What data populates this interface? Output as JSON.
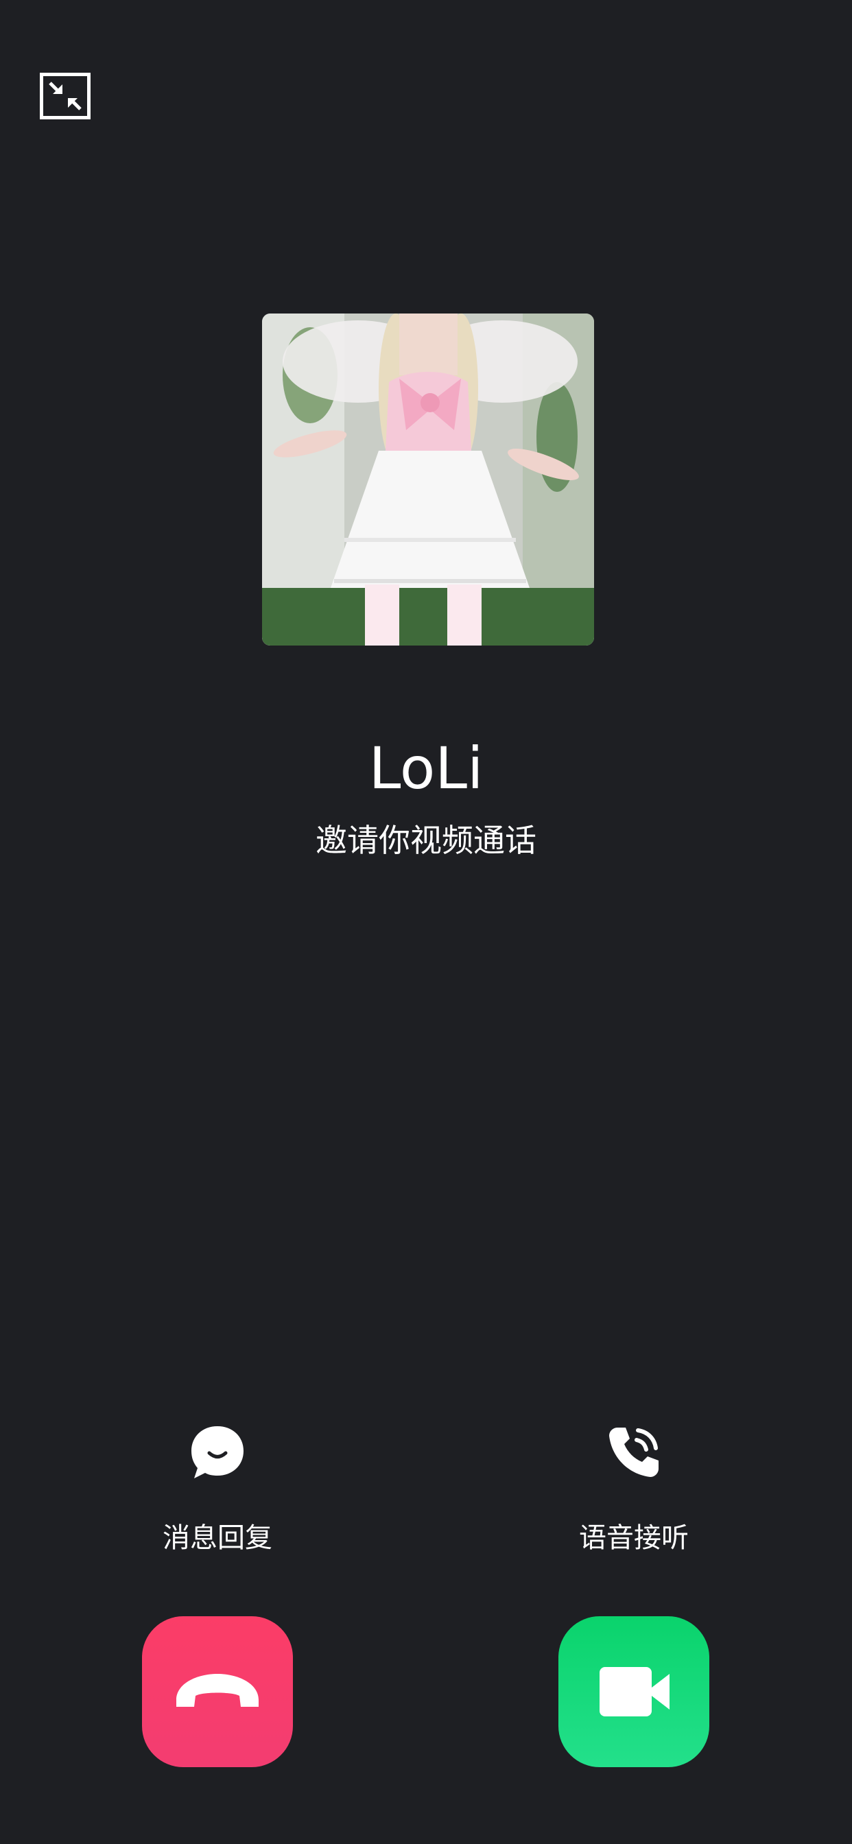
{
  "caller": {
    "name": "LoLi",
    "subtitle": "邀请你视频通话"
  },
  "options": {
    "message_reply_label": "消息回复",
    "voice_answer_label": "语音接听"
  },
  "icons": {
    "minimize": "minimize-icon",
    "message": "chat-bubble-icon",
    "voice": "phone-icon",
    "decline": "hang-up-icon",
    "accept": "video-camera-icon"
  },
  "colors": {
    "background": "#1e1f23",
    "decline": "#f83d6b",
    "accept": "#10d877"
  }
}
